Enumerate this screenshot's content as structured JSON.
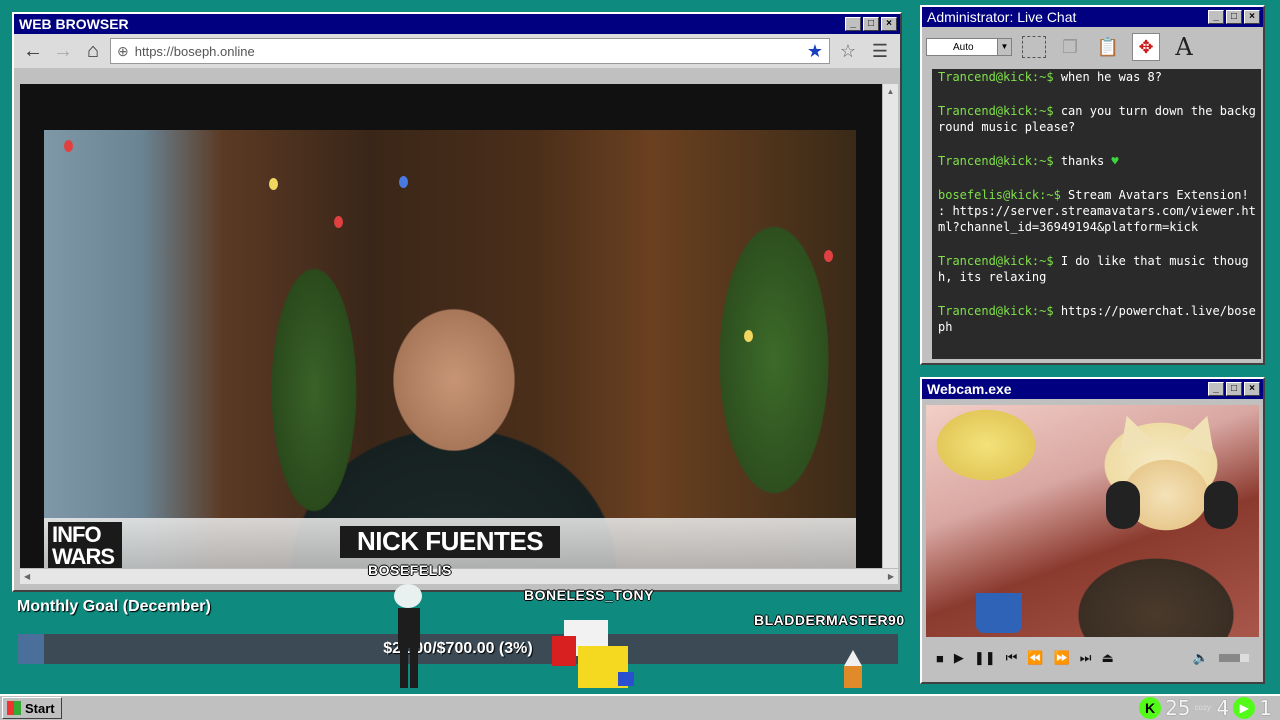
{
  "browser": {
    "title": "WEB BROWSER",
    "url": "https://boseph.online",
    "video": {
      "lower_third_logo": "INFO WARS",
      "name": "NICK FUENTES"
    }
  },
  "chat": {
    "title": "Administrator: Live Chat",
    "font_select": "Auto",
    "messages": [
      {
        "user": "Trancend@kick:~$",
        "text": " when he was 8?"
      },
      {
        "user": "Trancend@kick:~$",
        "text": " can you turn down the background music please?"
      },
      {
        "user": "Trancend@kick:~$",
        "text": " thanks ",
        "emoji": "♥"
      },
      {
        "user": "bosefelis@kick:~$",
        "text": " Stream Avatars Extension! : https://server.streamavatars.com/viewer.html?channel_id=36949194&platform=kick"
      },
      {
        "user": "Trancend@kick:~$",
        "text": " I do like that music though, its relaxing"
      },
      {
        "user": "Trancend@kick:~$",
        "text": " https://powerchat.live/boseph"
      }
    ]
  },
  "webcam": {
    "title": "Webcam.exe"
  },
  "goal": {
    "title": "Monthly Goal (December)",
    "progress_text": "$21.00/$700.00 (3%)",
    "percent": 3
  },
  "avatars": [
    {
      "name": "BOSEFELIS"
    },
    {
      "name": "BONELESS_TONY"
    },
    {
      "name": "BLADDERMASTER90"
    }
  ],
  "taskbar": {
    "start_label": "Start",
    "kick_count": "25",
    "cozy_label": "cozy",
    "viewers": "4",
    "play_count": "1"
  },
  "colors": {
    "desktop": "#0f8a7f",
    "titlebar": "#000080",
    "chat_user": "#7fe04a",
    "kick_green": "#53fc18"
  }
}
